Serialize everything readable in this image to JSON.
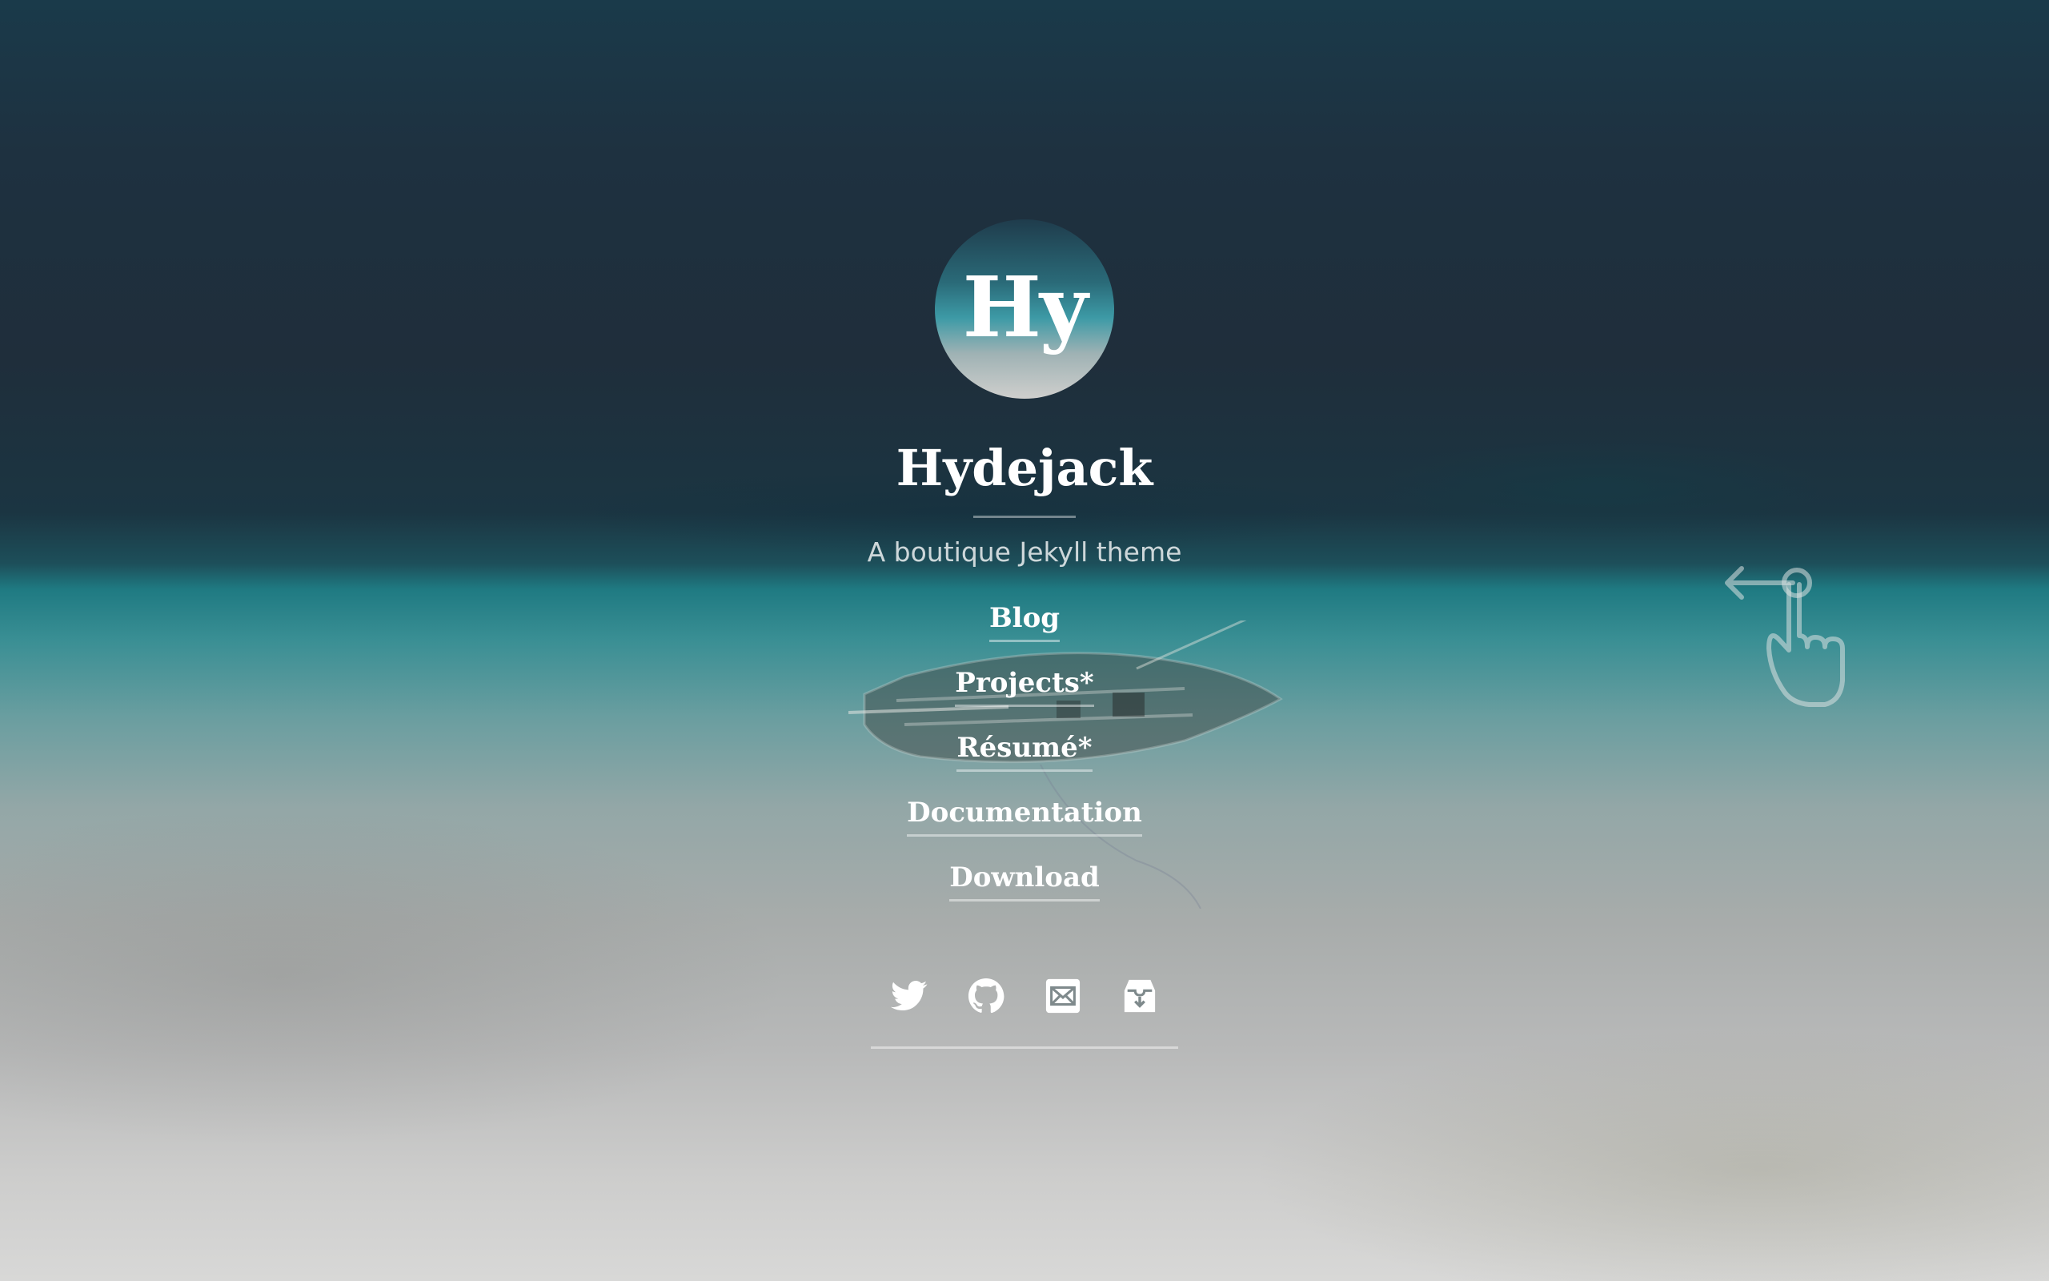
{
  "sidebar": {
    "avatar_text": "Hy",
    "title": "Hydejack",
    "tagline": "A boutique Jekyll theme",
    "nav": [
      {
        "label": "Blog"
      },
      {
        "label": "Projects*"
      },
      {
        "label": "Résumé*"
      },
      {
        "label": "Documentation"
      },
      {
        "label": "Download"
      }
    ],
    "social": [
      {
        "icon": "twitter-icon"
      },
      {
        "icon": "github-icon"
      },
      {
        "icon": "email-icon"
      },
      {
        "icon": "rss-icon"
      }
    ]
  },
  "swipe_hint": {
    "icon": "swipe-left-hand-icon"
  }
}
